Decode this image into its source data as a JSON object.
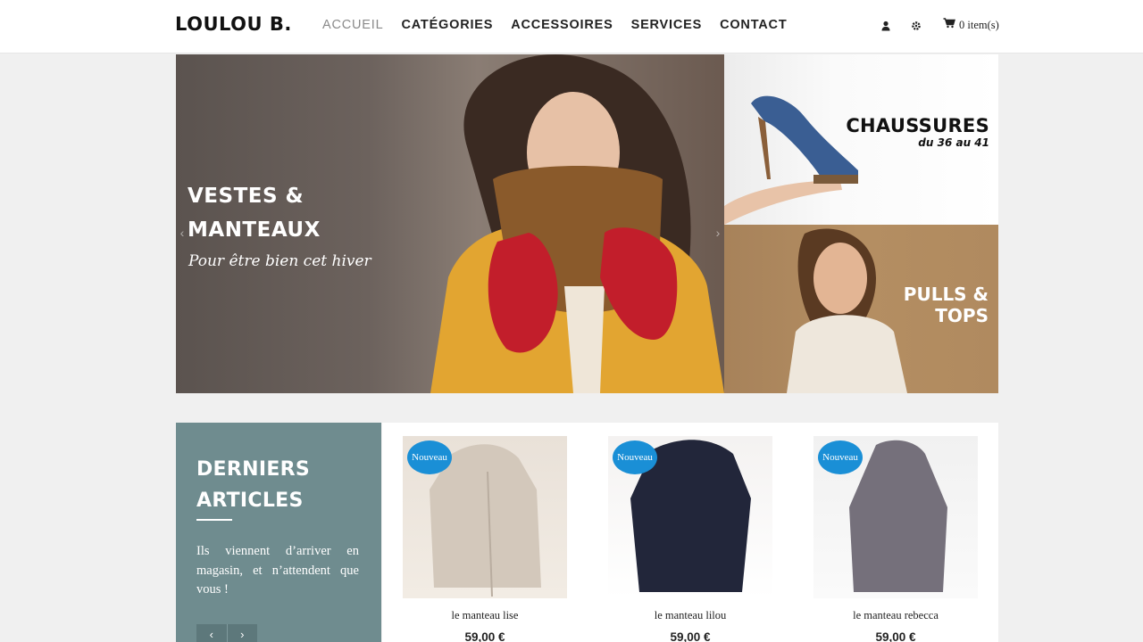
{
  "header": {
    "logo": "LOULOU B.",
    "nav": [
      "ACCUEIL",
      "CATÉGORIES",
      "ACCESSOIRES",
      "SERVICES",
      "CONTACT"
    ],
    "cart_label": "0 item(s)"
  },
  "hero": {
    "title_line1": "VESTES &",
    "title_line2": "MANTEAUX",
    "subtitle": "Pour être bien cet hiver"
  },
  "banners": {
    "shoes_title": "CHAUSSURES",
    "shoes_sub": "du 36 au 41",
    "pulls_line1": "PULLS &",
    "pulls_line2": "TOPS"
  },
  "latest": {
    "title_line1": "DERNIERS",
    "title_line2": "ARTICLES",
    "text": "Ils viennent d’arriver en magasin, et n’attendent que vous !",
    "prev": "‹",
    "next": "›"
  },
  "products": [
    {
      "badge": "Nouveau",
      "name": "le manteau lise",
      "price": "59,00 €"
    },
    {
      "badge": "Nouveau",
      "name": "le manteau lilou",
      "price": "59,00 €"
    },
    {
      "badge": "Nouveau",
      "name": "le manteau rebecca",
      "price": "59,00 €"
    }
  ]
}
